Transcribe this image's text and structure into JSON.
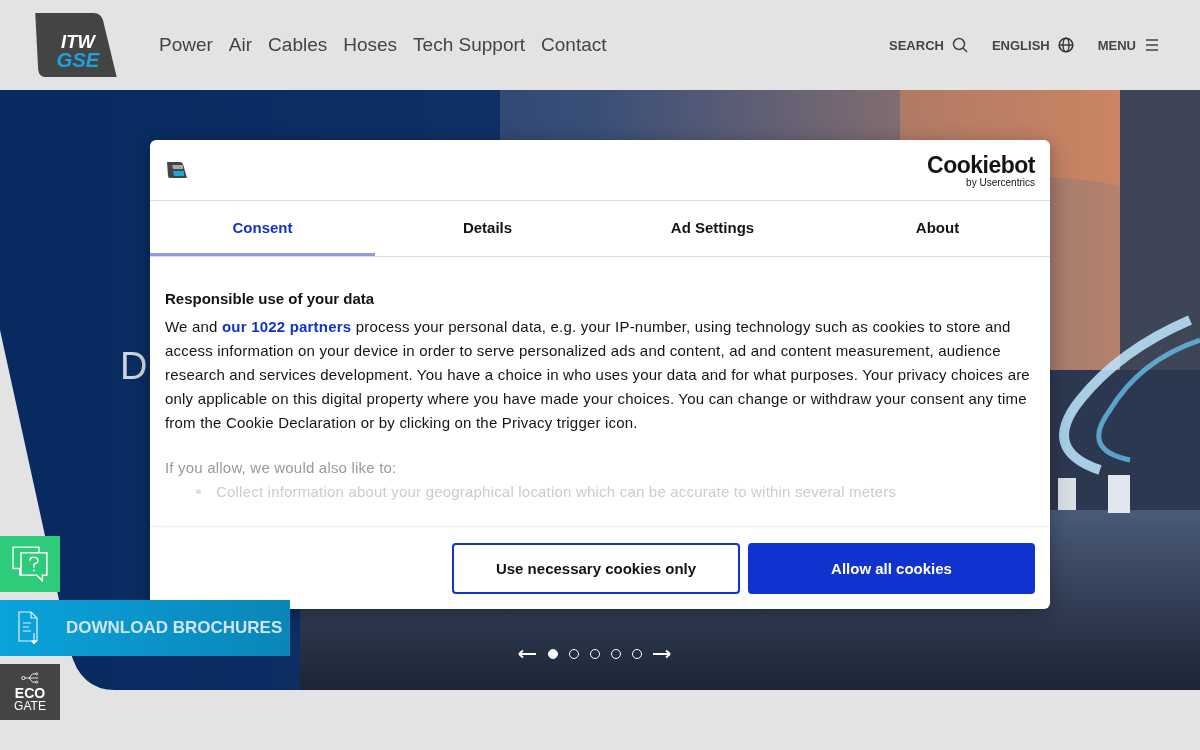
{
  "header": {
    "logo": {
      "line1": "ITW",
      "line2": "GSE"
    },
    "nav": [
      {
        "label": "Power"
      },
      {
        "label": "Air"
      },
      {
        "label": "Cables"
      },
      {
        "label": "Hoses"
      },
      {
        "label": "Tech Support"
      },
      {
        "label": "Contact"
      }
    ],
    "actions": [
      {
        "label": "SEARCH",
        "kind": "search"
      },
      {
        "label": "ENGLISH",
        "kind": "globe"
      },
      {
        "label": "MENU",
        "kind": "menu"
      }
    ]
  },
  "hero": {
    "kind": "picture",
    "heading": "D",
    "slides": [
      {
        "selected": true
      },
      {
        "selected": false
      },
      {
        "selected": false
      },
      {
        "selected": false
      },
      {
        "selected": false
      }
    ]
  },
  "side_tabs": [
    {
      "kind": "help"
    },
    {
      "kind": "download",
      "label": "DOWNLOAD BROCHURES"
    },
    {
      "kind": "eco",
      "line1": "ECO",
      "line2": "GATE"
    }
  ],
  "cookie_dialog": {
    "brand": {
      "name": "Cookiebot",
      "byline": "by Usercentrics"
    },
    "tabs": [
      {
        "label": "Consent",
        "selected": true
      },
      {
        "label": "Details",
        "selected": false
      },
      {
        "label": "Ad Settings",
        "selected": false
      },
      {
        "label": "About",
        "selected": false
      }
    ],
    "heading": "Responsible use of your data",
    "paragraph": {
      "before": "We and ",
      "link": "our 1022 partners",
      "after": " process your personal data, e.g. your IP-number, using technology such as cookies to store and access information on your device in order to serve personalized ads and content, ad and content measurement, audience research and services development. You have a choice in who uses your data and for what purposes. Your privacy choices are only applicable on this digital property where you have made your choices. You can change or withdraw your consent any time from the Cookie Declaration or by clicking on the Privacy trigger icon."
    },
    "intro": "If you allow, we would also like to:",
    "purposes": [
      "Collect information about your geographical location which can be accurate to within several meters"
    ],
    "buttons": [
      {
        "label": "Use necessary cookies only",
        "kind": "secondary"
      },
      {
        "label": "Allow all cookies",
        "kind": "primary"
      }
    ]
  }
}
